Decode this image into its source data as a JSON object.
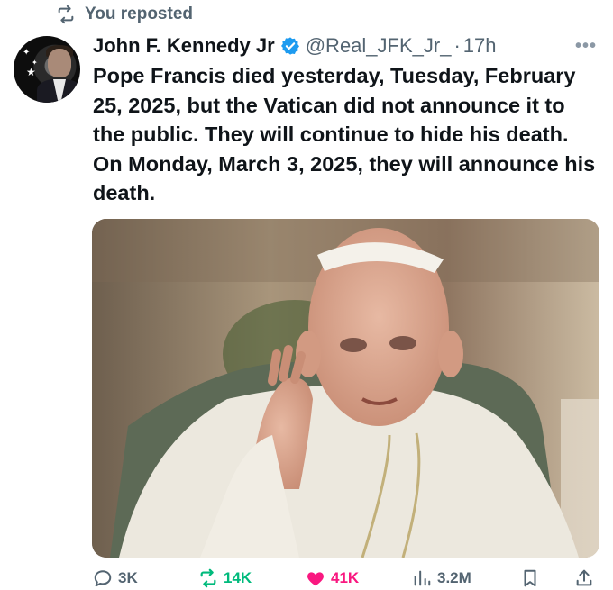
{
  "repost_banner": {
    "text": "You reposted",
    "icon": "repost-icon"
  },
  "author": {
    "name": "John F. Kennedy Jr",
    "verified": true,
    "handle": "@Real_JFK_Jr_",
    "separator": "·",
    "time": "17h",
    "avatar_icon": "avatar"
  },
  "more_icon": "more-icon",
  "tweet": {
    "text": "Pope Francis died yesterday, Tuesday, February 25, 2025, but the Vatican did not announce it to the public. They will continue to hide his death. On Monday, March 3, 2025, they will announce his death."
  },
  "media": {
    "icon": "photo-attachment"
  },
  "actions": {
    "reply_count": "3K",
    "repost_count": "14K",
    "like_count": "41K",
    "views_count": "3.2M",
    "bookmark_icon": "bookmark-icon",
    "share_icon": "share-icon"
  },
  "colors": {
    "text_primary": "#0f1419",
    "text_secondary": "#536471",
    "verified": "#1d9bf0",
    "repost_active": "#00ba7c",
    "like_active": "#f91880"
  }
}
